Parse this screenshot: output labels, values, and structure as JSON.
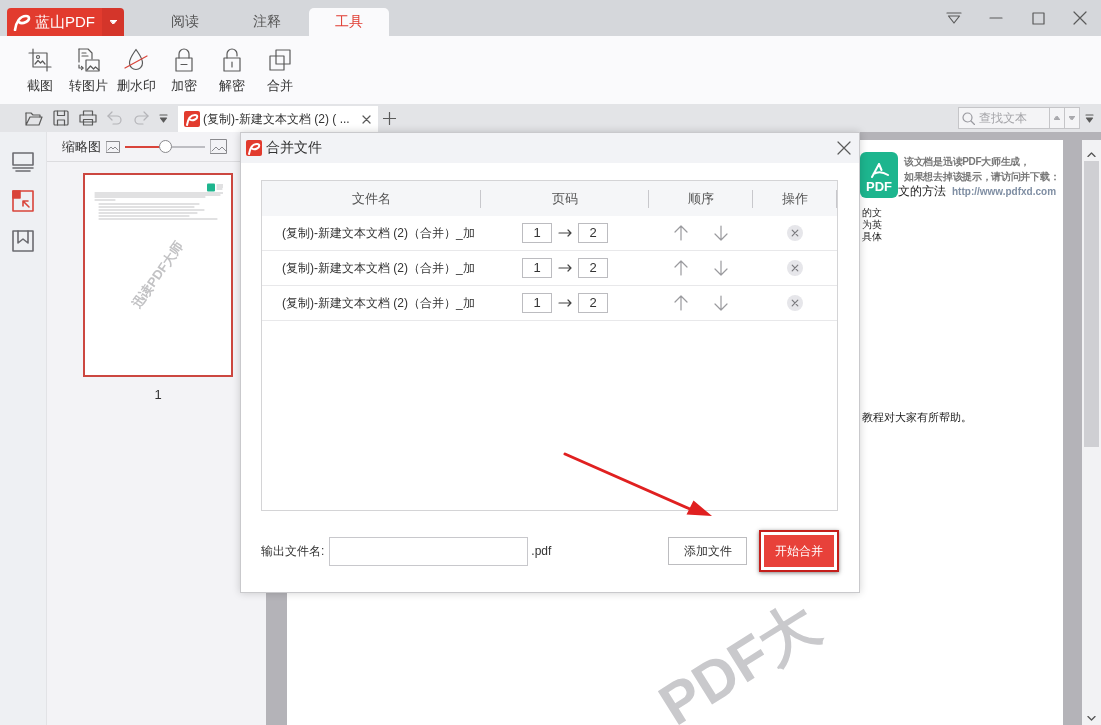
{
  "app": {
    "logo": "蓝山PDF",
    "menu_tabs": [
      {
        "label": "阅读",
        "selected": false
      },
      {
        "label": "注释",
        "selected": false
      },
      {
        "label": "工具",
        "selected": true
      }
    ]
  },
  "tools": [
    {
      "kind": "crop",
      "label": "截图"
    },
    {
      "kind": "convert",
      "label": "转图片"
    },
    {
      "kind": "watermark",
      "label": "删水印"
    },
    {
      "kind": "lock",
      "label": "加密"
    },
    {
      "kind": "unlock",
      "label": "解密"
    },
    {
      "kind": "merge",
      "label": "合并"
    }
  ],
  "quick_access": [
    {
      "kind": "open",
      "disabled": false
    },
    {
      "kind": "save",
      "disabled": false
    },
    {
      "kind": "print",
      "disabled": false
    },
    {
      "kind": "undo",
      "disabled": true
    },
    {
      "kind": "redo",
      "disabled": true
    },
    {
      "kind": "more",
      "disabled": false
    }
  ],
  "document_tabs": [
    {
      "title": "(复制)-新建文本文档 (2) ( ...",
      "selected": true
    }
  ],
  "search": {
    "placeholder": "查找文本"
  },
  "side_panel": [
    {
      "kind": "pages",
      "selected": false
    },
    {
      "kind": "thumbnails",
      "selected": true
    },
    {
      "kind": "bookmarks",
      "selected": false
    }
  ],
  "thumbnails": {
    "title": "缩略图",
    "zoom": {
      "level": 0.5
    },
    "pages": [
      {
        "number": "1",
        "selected": true,
        "watermark": "迅读PDF大师"
      }
    ]
  },
  "document": {
    "logo": "PDF",
    "notice": [
      "该文档是迅读PDF大师生成，",
      "如果想去掉该提示，请访问并下载："
    ],
    "heading": "文的方法",
    "link": "http://www.pdfxd.com",
    "body_lines": [
      "的文",
      "为英",
      "具体"
    ],
    "closing": "教程对大家有所帮助。",
    "watermark": "PDF大"
  },
  "dialog": {
    "title": "合并文件",
    "columns": [
      "文件名",
      "页码",
      "顺序",
      "操作"
    ],
    "rows": [
      {
        "file_name": "(复制)-新建文本文档 (2)（合并）_加",
        "page_from": "1",
        "page_to": "2"
      },
      {
        "file_name": "(复制)-新建文本文档 (2)（合并）_加",
        "page_from": "1",
        "page_to": "2"
      },
      {
        "file_name": "(复制)-新建文本文档 (2)（合并）_加",
        "page_from": "1",
        "page_to": "2"
      }
    ],
    "output": {
      "label": "输出文件名:",
      "extension": ".pdf"
    },
    "buttons": [
      {
        "kind": "secondary",
        "label": "添加文件",
        "highlighted": false
      },
      {
        "kind": "primary",
        "label": "开始合并",
        "highlighted": true
      }
    ]
  }
}
